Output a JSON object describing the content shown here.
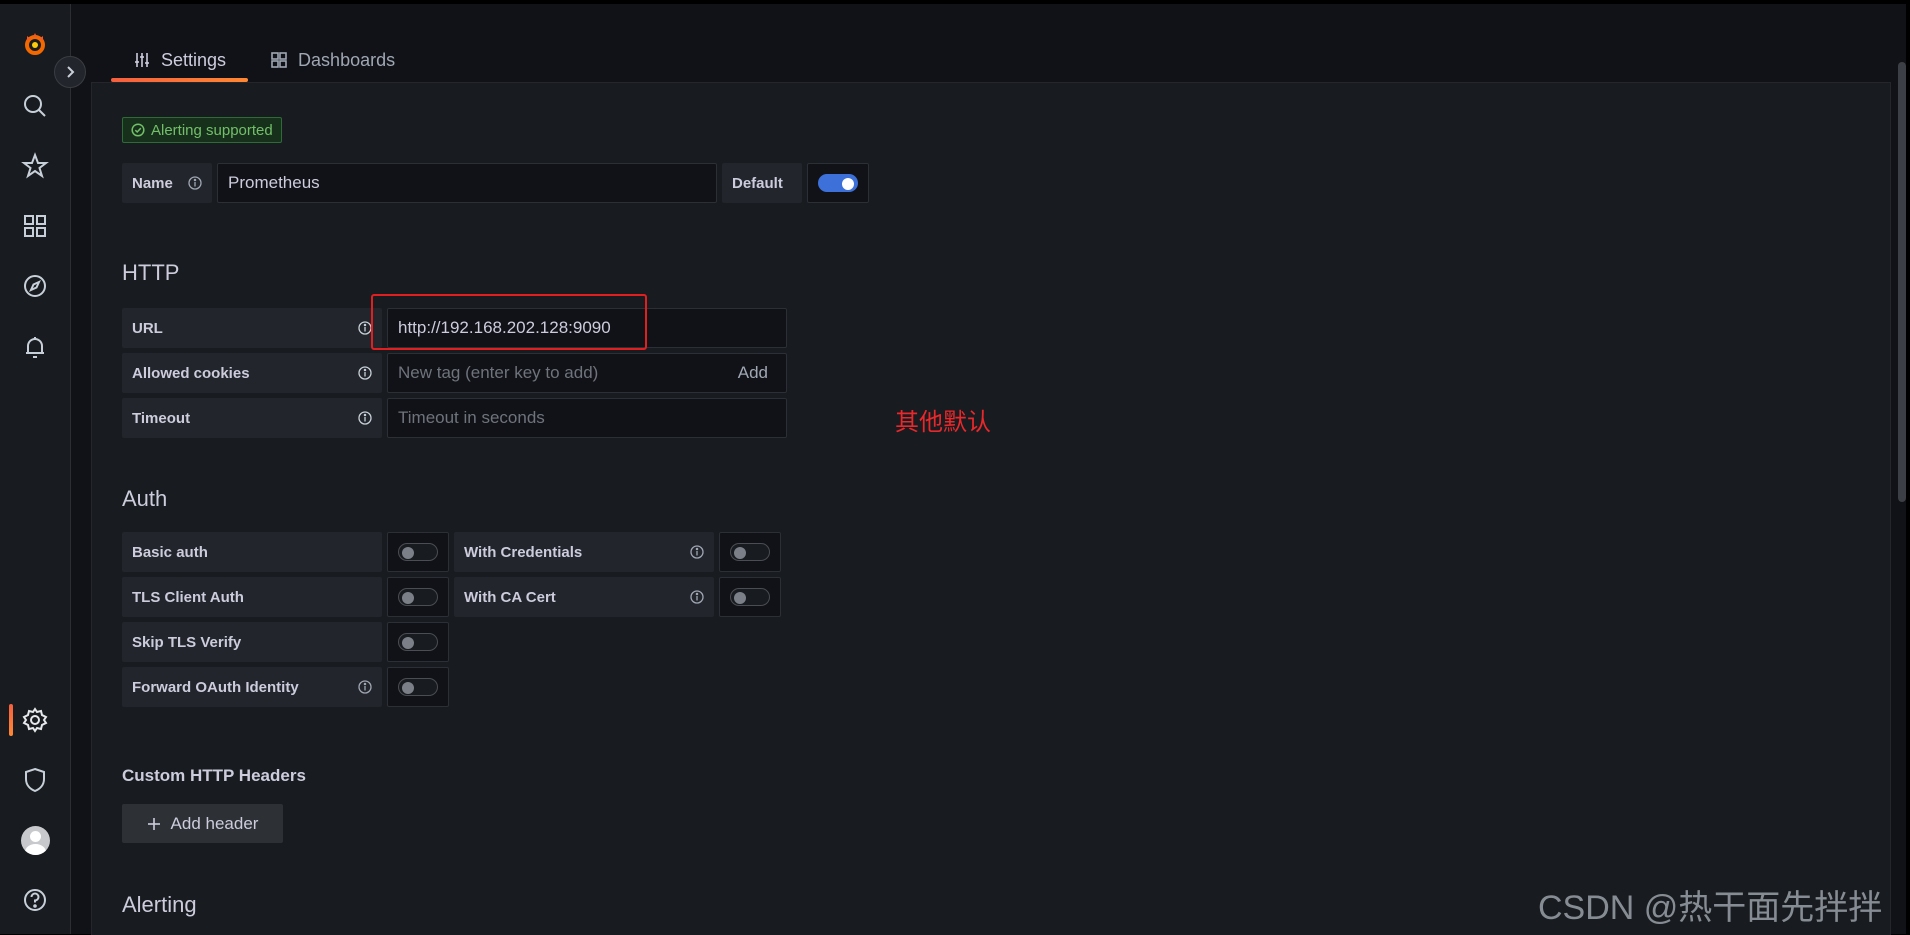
{
  "tabs": [
    {
      "label": "Settings",
      "icon": "sliders-icon",
      "active": true
    },
    {
      "label": "Dashboards",
      "icon": "apps-icon",
      "active": false
    }
  ],
  "badge": {
    "label": "Alerting supported"
  },
  "name_row": {
    "label": "Name",
    "value": "Prometheus",
    "default_label": "Default",
    "default_on": true
  },
  "http": {
    "title": "HTTP",
    "url_label": "URL",
    "url_value": "http://192.168.202.128:9090",
    "cookies_label": "Allowed cookies",
    "cookies_placeholder": "New tag (enter key to add)",
    "cookies_add": "Add",
    "timeout_label": "Timeout",
    "timeout_placeholder": "Timeout in seconds"
  },
  "auth": {
    "title": "Auth",
    "basic_auth": "Basic auth",
    "with_credentials": "With Credentials",
    "tls_client_auth": "TLS Client Auth",
    "with_ca_cert": "With CA Cert",
    "skip_tls_verify": "Skip TLS Verify",
    "forward_oauth": "Forward OAuth Identity"
  },
  "custom_headers": {
    "title": "Custom HTTP Headers",
    "add_label": "Add header"
  },
  "alerting": {
    "title": "Alerting"
  },
  "annotation": {
    "note": "其他默认"
  },
  "watermark": {
    "text": "CSDN @热干面先拌拌"
  },
  "colors": {
    "accent": "#f55f3e",
    "toggle_on": "#3d71d9",
    "annotation": "#e02020",
    "success": "#73bf69"
  }
}
